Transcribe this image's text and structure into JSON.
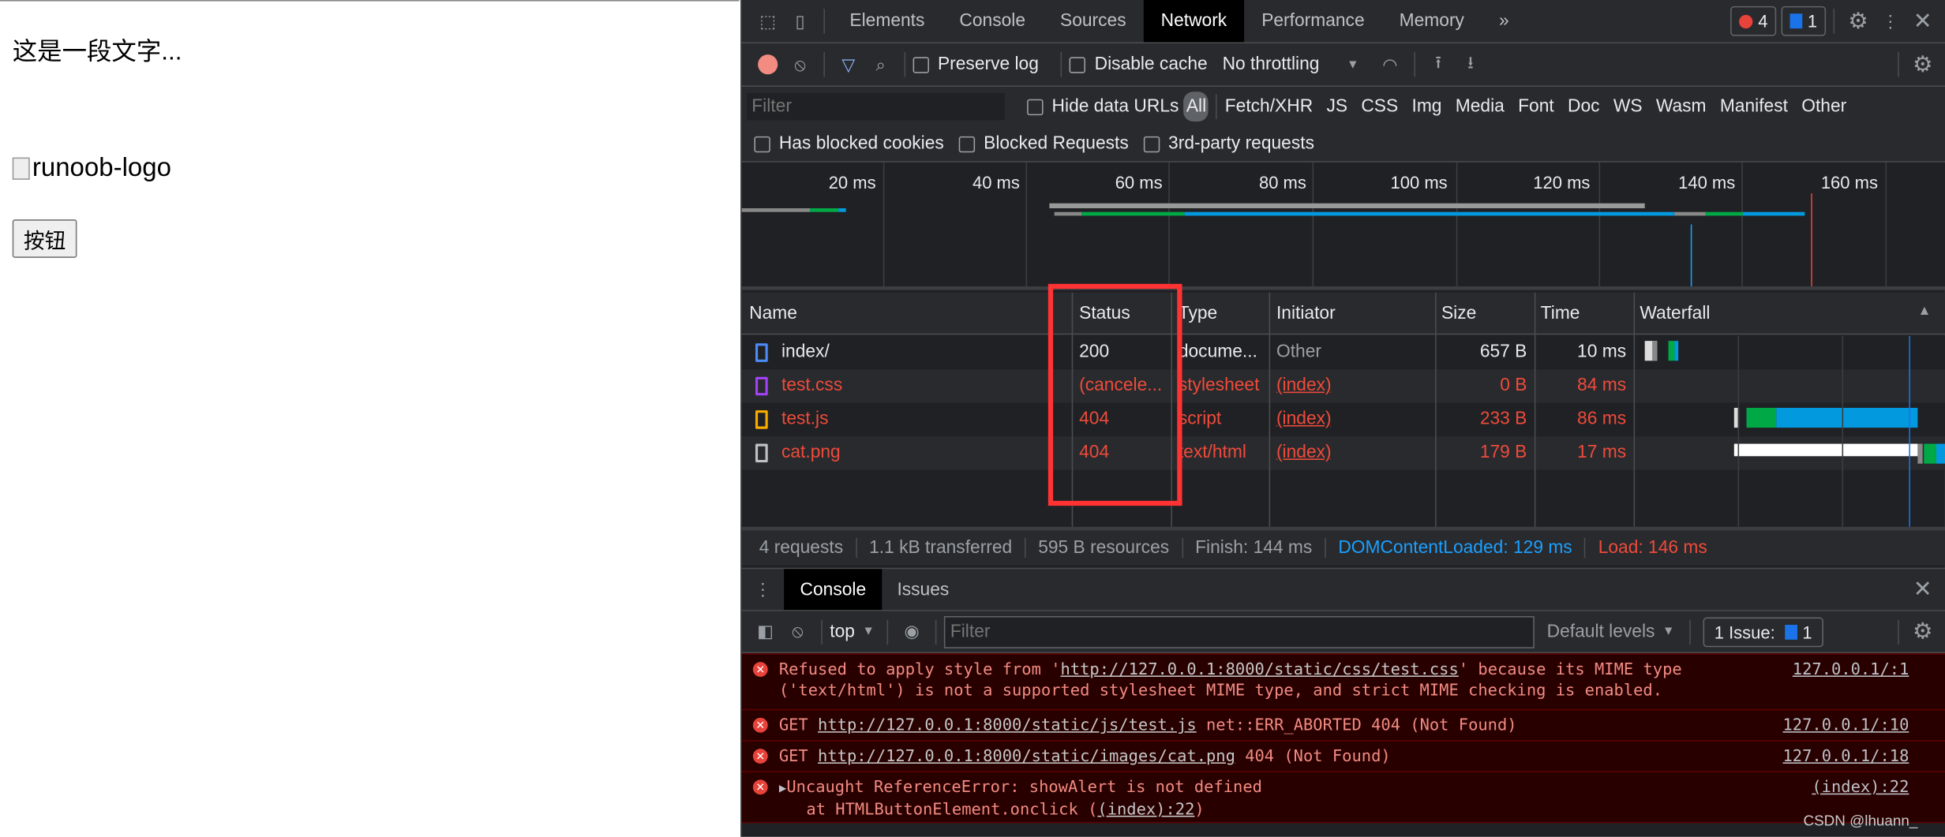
{
  "page": {
    "text": "这是一段文字...",
    "image_alt": "runoob-logo",
    "button": "按钮"
  },
  "devtools": {
    "tabs": [
      "Elements",
      "Console",
      "Sources",
      "Network",
      "Performance",
      "Memory"
    ],
    "active_tab": "Network",
    "more": "»",
    "error_count": "4",
    "message_count": "1",
    "toolbar": {
      "preserve_log": "Preserve log",
      "disable_cache": "Disable cache",
      "throttling": "No throttling"
    },
    "filter": {
      "placeholder": "Filter",
      "hide_data_urls": "Hide data URLs",
      "types": [
        "All",
        "Fetch/XHR",
        "JS",
        "CSS",
        "Img",
        "Media",
        "Font",
        "Doc",
        "WS",
        "Wasm",
        "Manifest",
        "Other"
      ],
      "has_blocked_cookies": "Has blocked cookies",
      "blocked_requests": "Blocked Requests",
      "third_party": "3rd-party requests"
    },
    "overview": {
      "ticks": [
        "20 ms",
        "40 ms",
        "60 ms",
        "80 ms",
        "100 ms",
        "120 ms",
        "140 ms",
        "160 ms"
      ],
      "colors": {
        "dom_content_loaded": "#1a73e8",
        "load": "#e8433a",
        "waiting": "#00a846",
        "download": "#0299de"
      }
    },
    "table": {
      "headers": [
        "Name",
        "Status",
        "Type",
        "Initiator",
        "Size",
        "Time",
        "Waterfall"
      ],
      "rows": [
        {
          "name": "index/",
          "status": "200",
          "type": "docume...",
          "initiator": "Other",
          "size": "657 B",
          "time": "10 ms",
          "icon": "document-icon",
          "error": false
        },
        {
          "name": "test.css",
          "status": "(cancele...",
          "type": "stylesheet",
          "initiator": "(index)",
          "size": "0 B",
          "time": "84 ms",
          "icon": "stylesheet-icon",
          "error": true
        },
        {
          "name": "test.js",
          "status": "404",
          "type": "script",
          "initiator": "(index)",
          "size": "233 B",
          "time": "86 ms",
          "icon": "script-icon",
          "error": true
        },
        {
          "name": "cat.png",
          "status": "404",
          "type": "text/html",
          "initiator": "(index)",
          "size": "179 B",
          "time": "17 ms",
          "icon": "image-icon",
          "error": true
        }
      ]
    },
    "summary": {
      "requests": "4 requests",
      "transferred": "1.1 kB transferred",
      "resources": "595 B resources",
      "finish": "Finish: 144 ms",
      "dcl": "DOMContentLoaded: 129 ms",
      "load": "Load: 146 ms"
    },
    "drawer": {
      "tabs": [
        "Console",
        "Issues"
      ],
      "context": "top",
      "filter_placeholder": "Filter",
      "levels": "Default levels",
      "issues": "1 Issue:",
      "issues_count": "1"
    },
    "console": [
      {
        "pre": "Refused to apply style from '",
        "url": "http://127.0.0.1:8000/static/css/test.css",
        "post": "' because its MIME type ('text/html') is not a supported stylesheet MIME type, and strict MIME checking is enabled.",
        "src": "127.0.0.1/:1"
      },
      {
        "pre": "GET ",
        "url": "http://127.0.0.1:8000/static/js/test.js",
        "post": " net::ERR_ABORTED 404 (Not Found)",
        "src": "127.0.0.1/:10"
      },
      {
        "pre": "GET ",
        "url": "http://127.0.0.1:8000/static/images/cat.png",
        "post": " 404 (Not Found)",
        "src": "127.0.0.1/:18"
      },
      {
        "pre": "Uncaught ReferenceError: showAlert is not defined",
        "stack_pre": "at HTMLButtonElement.onclick (",
        "stack_link": "(index):22",
        "stack_post": ")",
        "src": "(index):22"
      }
    ],
    "watermark": "CSDN @lhuann_"
  }
}
